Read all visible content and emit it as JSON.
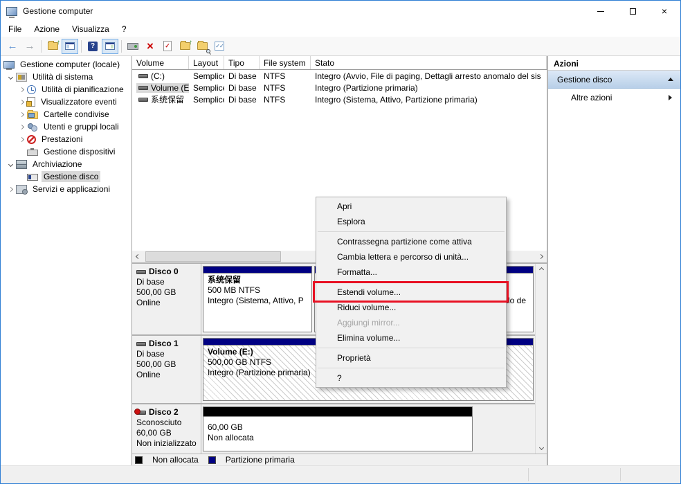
{
  "window": {
    "title": "Gestione computer",
    "controls": [
      "minimize-icon",
      "maximize-icon",
      "close-icon"
    ]
  },
  "menubar": {
    "items": [
      "File",
      "Azione",
      "Visualizza",
      "?"
    ]
  },
  "toolbar": {
    "icons": [
      "back-icon",
      "forward-icon",
      "up-one-level-icon",
      "show-console-tree-icon",
      "help-icon",
      "show-action-pane-icon",
      "slide-icon",
      "delete-icon",
      "properties-icon",
      "export-list-icon",
      "find-icon",
      "tasks-icon"
    ]
  },
  "tree": {
    "items": [
      {
        "label": "Gestione computer (locale)"
      },
      {
        "label": "Utilità di sistema"
      },
      {
        "label": "Utilità di pianificazione"
      },
      {
        "label": "Visualizzatore eventi"
      },
      {
        "label": "Cartelle condivise"
      },
      {
        "label": "Utenti e gruppi locali"
      },
      {
        "label": "Prestazioni"
      },
      {
        "label": "Gestione dispositivi"
      },
      {
        "label": "Archiviazione"
      },
      {
        "label": "Gestione disco"
      },
      {
        "label": "Servizi e applicazioni"
      }
    ]
  },
  "volume_table": {
    "columns": [
      "Volume",
      "Layout",
      "Tipo",
      "File system",
      "Stato"
    ],
    "rows": [
      {
        "volume": "(C:)",
        "layout": "Semplice",
        "tipo": "Di base",
        "fs": "NTFS",
        "stato": "Integro (Avvio, File di paging, Dettagli arresto anomalo del sis"
      },
      {
        "volume": "Volume (E:)",
        "layout": "Semplice",
        "tipo": "Di base",
        "fs": "NTFS",
        "stato": "Integro (Partizione primaria)"
      },
      {
        "volume": "系统保留",
        "layout": "Semplice",
        "tipo": "Di base",
        "fs": "NTFS",
        "stato": "Integro (Sistema, Attivo, Partizione primaria)"
      }
    ]
  },
  "actions": {
    "title": "Azioni",
    "group": "Gestione disco",
    "more": "Altre azioni"
  },
  "disks": [
    {
      "name": "Disco 0",
      "type": "Di base",
      "size": "500,00 GB",
      "status": "Online",
      "part1": {
        "title": "系统保留",
        "size": "500 MB NTFS",
        "status": "Integro (Sistema, Attivo, P"
      },
      "part2": {
        "visible_fragment": "alo de"
      }
    },
    {
      "name": "Disco 1",
      "type": "Di base",
      "size": "500,00 GB",
      "status": "Online",
      "part1": {
        "title": "Volume  (E:)",
        "size": "500,00 GB NTFS",
        "status": "Integro (Partizione primaria)"
      }
    },
    {
      "name": "Disco 2",
      "type": "Sconosciuto",
      "size": "60,00 GB",
      "status": "Non inizializzato",
      "part1": {
        "size": "60,00 GB",
        "status": "Non allocata"
      }
    }
  ],
  "legend": {
    "unallocated": "Non allocata",
    "primary": "Partizione primaria"
  },
  "context_menu": {
    "items": [
      {
        "label": "Apri"
      },
      {
        "label": "Esplora"
      },
      {
        "label": "Contrassegna partizione come attiva"
      },
      {
        "label": "Cambia lettera e percorso di unità..."
      },
      {
        "label": "Formatta..."
      },
      {
        "label": "Estendi volume...",
        "highlighted": true
      },
      {
        "label": "Riduci volume..."
      },
      {
        "label": "Aggiungi mirror...",
        "disabled": true
      },
      {
        "label": "Elimina volume..."
      },
      {
        "label": "Proprietà"
      },
      {
        "label": "?"
      }
    ]
  },
  "colors": {
    "partition_primary": "#000082",
    "unallocated": "#000000",
    "highlight_red": "#e81123",
    "selection_gray": "#d9d9d9"
  }
}
